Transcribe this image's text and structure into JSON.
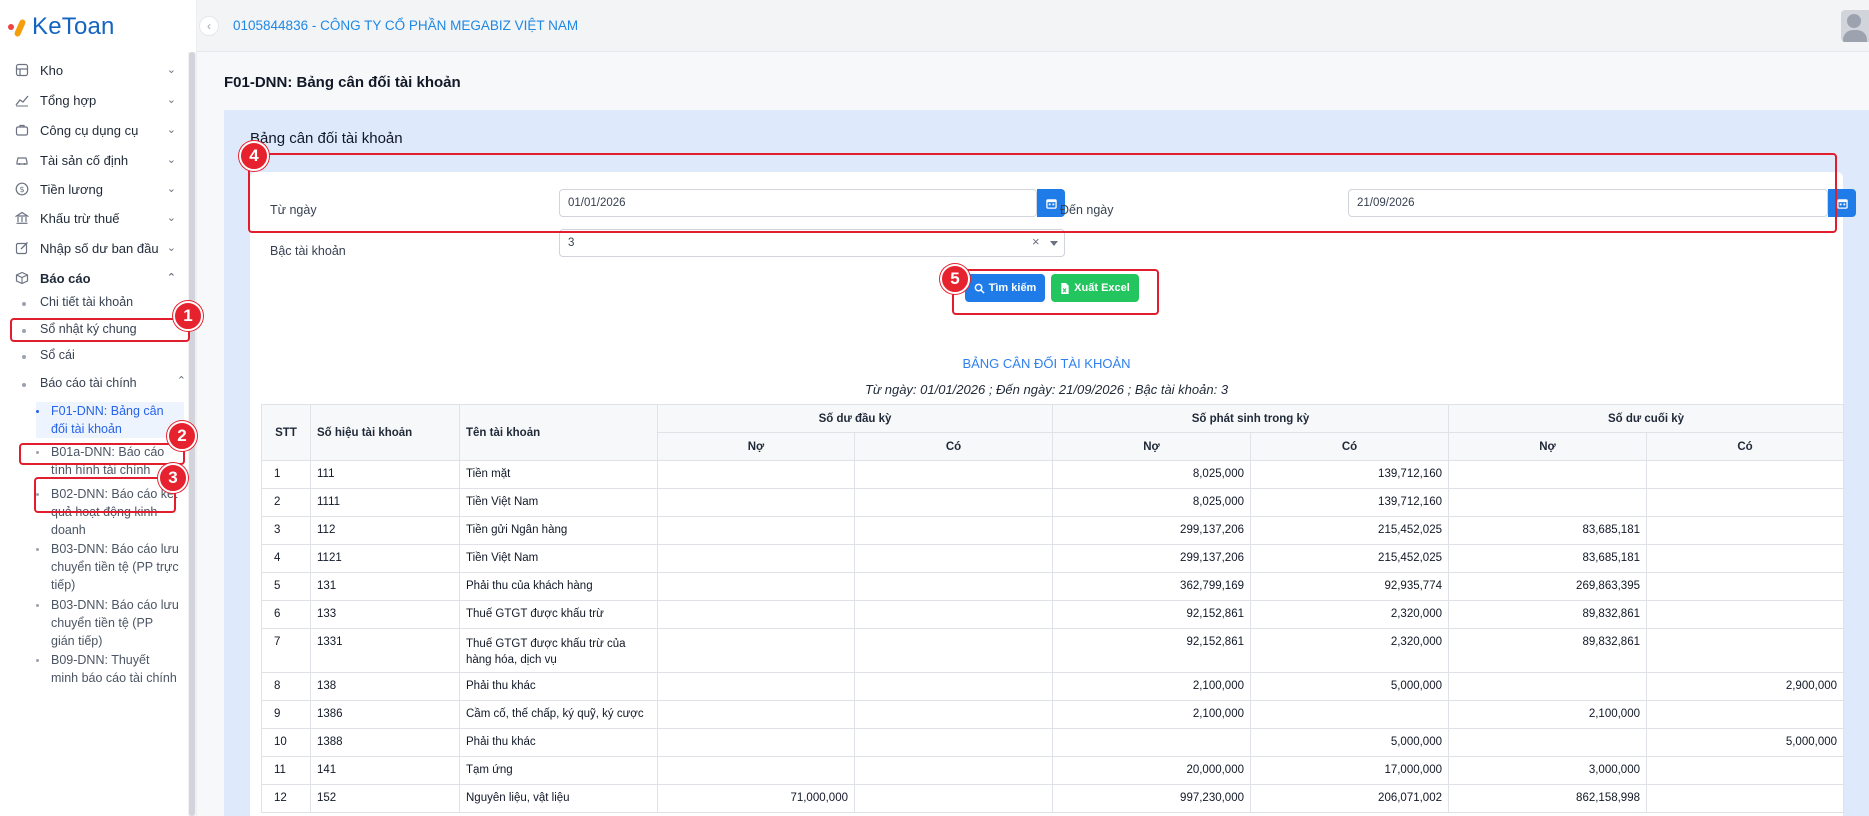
{
  "logo": {
    "text": "KeToan"
  },
  "header": {
    "company": "0105844836 - CÔNG TY CỔ PHẦN MEGABIZ VIỆT NAM"
  },
  "page_title": "F01-DNN: Bảng cân đối tài khoản",
  "sidebar": {
    "menu": [
      {
        "label": "Kho",
        "icon": "warehouse-icon"
      },
      {
        "label": "Tổng hợp",
        "icon": "trend-chart-icon"
      },
      {
        "label": "Công cụ dụng cụ",
        "icon": "toolbox-icon"
      },
      {
        "label": "Tài sản cố định",
        "icon": "car-icon"
      },
      {
        "label": "Tiền lương",
        "icon": "dollar-circle-icon"
      },
      {
        "label": "Khấu trừ thuế",
        "icon": "bank-icon"
      },
      {
        "label": "Nhập số dư ban đầu",
        "icon": "edit-icon"
      },
      {
        "label": "Báo cáo",
        "icon": "box-icon"
      }
    ],
    "report_sub": [
      {
        "label": "Chi tiết tài khoản"
      },
      {
        "label": "Sổ nhật ký chung"
      },
      {
        "label": "Sổ cái"
      },
      {
        "label": "Báo cáo tài chính"
      }
    ],
    "financial_reports": [
      {
        "label": "F01-DNN: Bảng cân đối tài khoản"
      },
      {
        "label": "B01a-DNN: Báo cáo tình hình tài chính"
      },
      {
        "label": "B02-DNN: Báo cáo kết quả hoạt động kinh doanh"
      },
      {
        "label": "B03-DNN: Báo cáo lưu chuyển tiền tệ (PP trực tiếp)"
      },
      {
        "label": "B03-DNN: Báo cáo lưu chuyển tiền tệ (PP gián tiếp)"
      },
      {
        "label": "B09-DNN: Thuyết minh báo cáo tài chính"
      }
    ]
  },
  "section_title": "Bảng cân đối tài khoản",
  "filters": {
    "from_label": "Từ ngày",
    "from_value": "01/01/2026",
    "to_label": "Đến ngày",
    "to_value": "21/09/2026",
    "level_label": "Bậc tài khoản",
    "level_value": "3",
    "clear": "×"
  },
  "buttons": {
    "search": "Tìm kiếm",
    "excel": "Xuất Excel"
  },
  "callouts": [
    "1",
    "2",
    "3",
    "4",
    "5"
  ],
  "report": {
    "title": "BẢNG CÂN ĐỐI TÀI KHOẢN",
    "subtitle": "Từ ngày: 01/01/2026 ; Đến ngày: 21/09/2026 ; Bậc tài khoản: 3",
    "headers": {
      "stt": "STT",
      "code": "Số hiệu tài khoản",
      "name": "Tên tài khoản",
      "opening": "Số dư đầu kỳ",
      "period": "Số phát sinh trong kỳ",
      "closing": "Số dư cuối kỳ",
      "debit": "Nợ",
      "credit": "Có"
    },
    "rows": [
      {
        "stt": "1",
        "code": "111",
        "name": "Tiền mặt",
        "od": "",
        "oc": "",
        "pd": "8,025,000",
        "pc": "139,712,160",
        "cd": "",
        "cc": ""
      },
      {
        "stt": "2",
        "code": "1111",
        "name": "Tiền Việt Nam",
        "od": "",
        "oc": "",
        "pd": "8,025,000",
        "pc": "139,712,160",
        "cd": "",
        "cc": ""
      },
      {
        "stt": "3",
        "code": "112",
        "name": "Tiền gửi Ngân hàng",
        "od": "",
        "oc": "",
        "pd": "299,137,206",
        "pc": "215,452,025",
        "cd": "83,685,181",
        "cc": ""
      },
      {
        "stt": "4",
        "code": "1121",
        "name": "Tiền Việt Nam",
        "od": "",
        "oc": "",
        "pd": "299,137,206",
        "pc": "215,452,025",
        "cd": "83,685,181",
        "cc": ""
      },
      {
        "stt": "5",
        "code": "131",
        "name": "Phải thu của khách hàng",
        "od": "",
        "oc": "",
        "pd": "362,799,169",
        "pc": "92,935,774",
        "cd": "269,863,395",
        "cc": ""
      },
      {
        "stt": "6",
        "code": "133",
        "name": "Thuế GTGT được khấu trừ",
        "od": "",
        "oc": "",
        "pd": "92,152,861",
        "pc": "2,320,000",
        "cd": "89,832,861",
        "cc": ""
      },
      {
        "stt": "7",
        "code": "1331",
        "name": "Thuế GTGT được khấu trừ của hàng hóa, dịch vụ",
        "od": "",
        "oc": "",
        "pd": "92,152,861",
        "pc": "2,320,000",
        "cd": "89,832,861",
        "cc": ""
      },
      {
        "stt": "8",
        "code": "138",
        "name": "Phải thu khác",
        "od": "",
        "oc": "",
        "pd": "2,100,000",
        "pc": "5,000,000",
        "cd": "",
        "cc": "2,900,000"
      },
      {
        "stt": "9",
        "code": "1386",
        "name": "Cầm cố, thế chấp, ký quỹ, ký cược",
        "od": "",
        "oc": "",
        "pd": "2,100,000",
        "pc": "",
        "cd": "2,100,000",
        "cc": ""
      },
      {
        "stt": "10",
        "code": "1388",
        "name": "Phải thu khác",
        "od": "",
        "oc": "",
        "pd": "",
        "pc": "5,000,000",
        "cd": "",
        "cc": "5,000,000"
      },
      {
        "stt": "11",
        "code": "141",
        "name": "Tạm ứng",
        "od": "",
        "oc": "",
        "pd": "20,000,000",
        "pc": "17,000,000",
        "cd": "3,000,000",
        "cc": ""
      },
      {
        "stt": "12",
        "code": "152",
        "name": "Nguyên liệu, vật liệu",
        "od": "71,000,000",
        "oc": "",
        "pd": "997,230,000",
        "pc": "206,071,002",
        "cd": "862,158,998",
        "cc": ""
      }
    ]
  },
  "colors": {
    "primary": "#1e7be8",
    "success": "#22c55e",
    "callout": "#e5222e",
    "accent_text": "#1e88e5"
  }
}
